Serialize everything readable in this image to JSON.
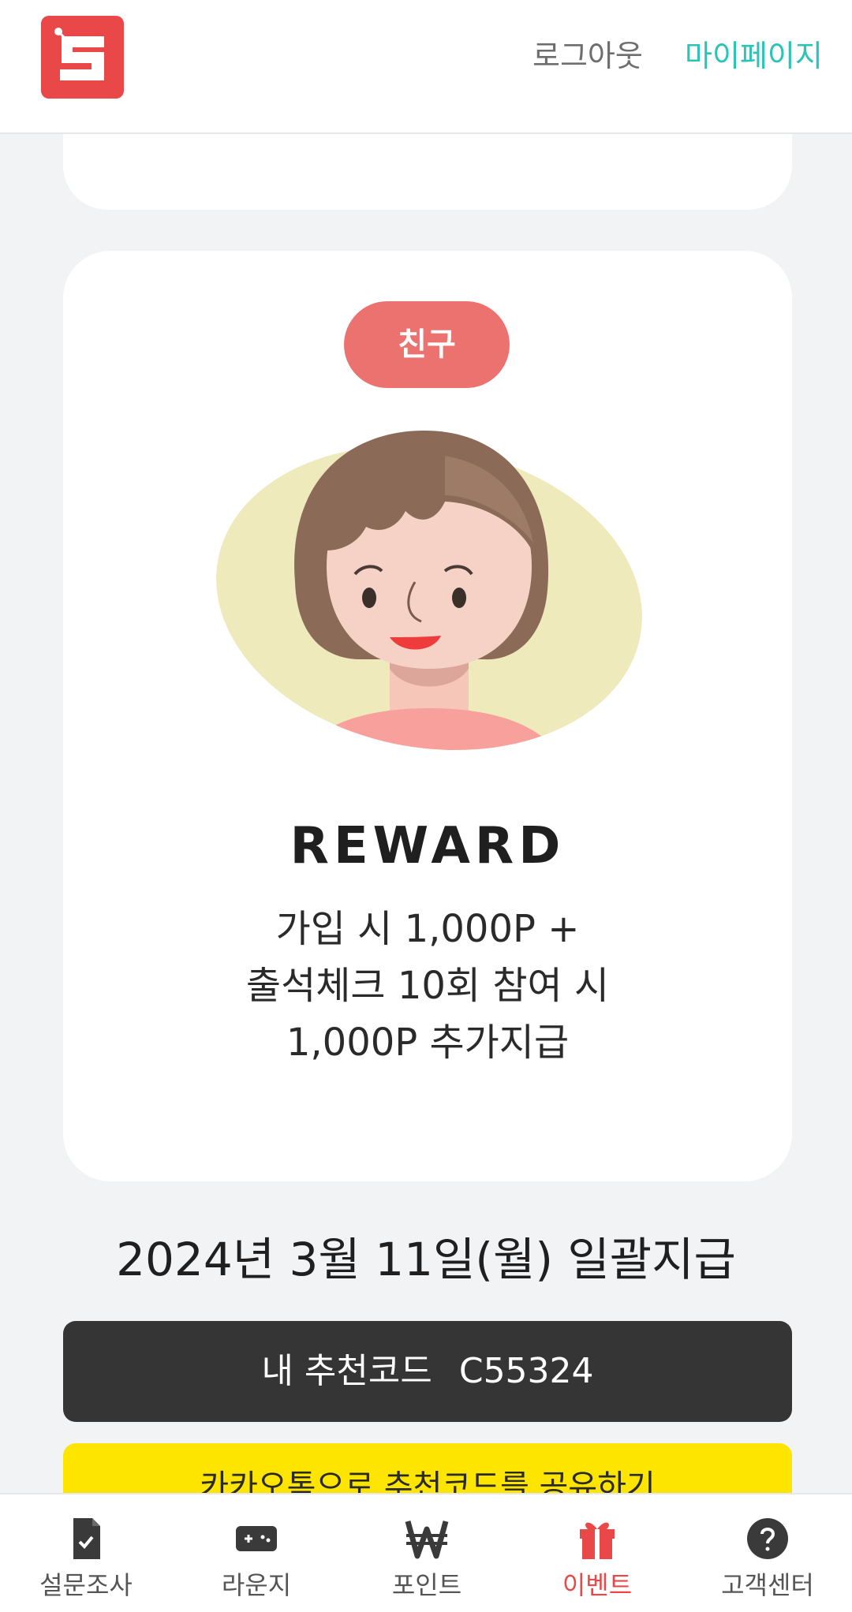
{
  "header": {
    "logo_icon": "s-logo-icon",
    "logout_label": "로그아웃",
    "mypage_label": "마이페이지"
  },
  "reward_card": {
    "tag_label": "친구",
    "title": "REWARD",
    "desc_line1": "가입 시 1,000P +",
    "desc_line2": "출석체크 10회 참여 시",
    "desc_line3": "1,000P 추가지급"
  },
  "payment_date": "2024년 3월 11일(월) 일괄지급",
  "referral": {
    "label": "내 추천코드",
    "code": "C55324"
  },
  "kakao_share_label": "카카오톡으로 추천코드를 공유하기",
  "bottom_nav": [
    {
      "label": "설문조사",
      "icon": "survey-icon"
    },
    {
      "label": "라운지",
      "icon": "gamepad-icon"
    },
    {
      "label": "포인트",
      "icon": "won-icon"
    },
    {
      "label": "이벤트",
      "icon": "gift-icon",
      "active": true
    },
    {
      "label": "고객센터",
      "icon": "help-icon"
    }
  ],
  "colors": {
    "brand_red": "#ea4848",
    "accent_teal": "#2cc3b8",
    "kakao_yellow": "#fde500",
    "dark_bar": "#353535"
  }
}
